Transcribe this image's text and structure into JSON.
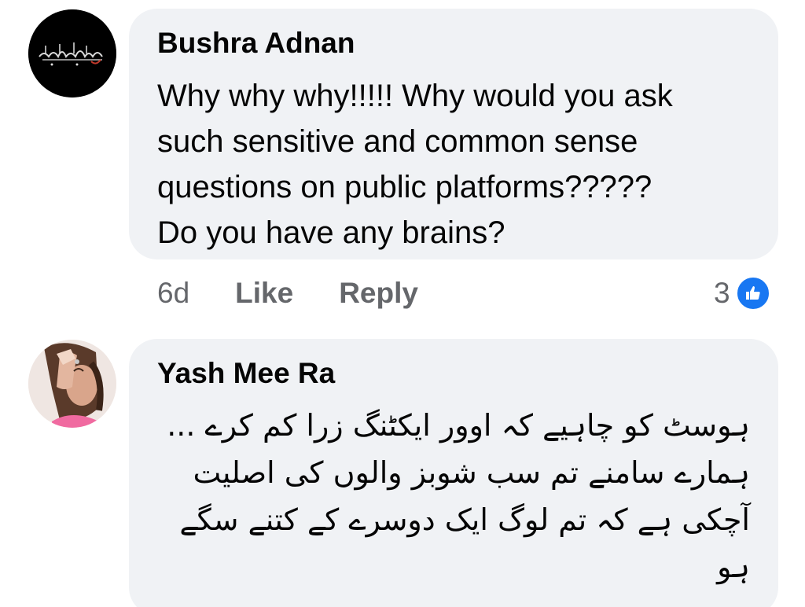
{
  "comments": [
    {
      "author": "Bushra Adnan",
      "avatar": {
        "name": "black-avatar-arabic-calligraphy",
        "background": "#000000",
        "accent": "#c0392b"
      },
      "lines": [
        "Why why why!!!!! Why would you ask",
        "such sensitive and common sense",
        "questions on public platforms?????",
        "Do you have any brains?"
      ],
      "time": "6d",
      "like_label": "Like",
      "reply_label": "Reply",
      "reaction_count": "3"
    },
    {
      "author": "Yash Mee Ra",
      "avatar": {
        "name": "photo-avatar-person"
      },
      "lines": [
        "ہوسٹ کو چاہیے کہ اوور ایکٹنگ زرا کم کرے ...",
        "ہمارے سامنے تم سب شوبز والوں کی اصلیت",
        "آچکی ہے کہ تم لوگ ایک دوسرے کے کتنے سگے",
        "ہو"
      ]
    }
  ],
  "colors": {
    "bubble": "#f0f2f5",
    "text": "#050505",
    "secondary_text": "#65676b",
    "like_blue": "#1877f2"
  }
}
